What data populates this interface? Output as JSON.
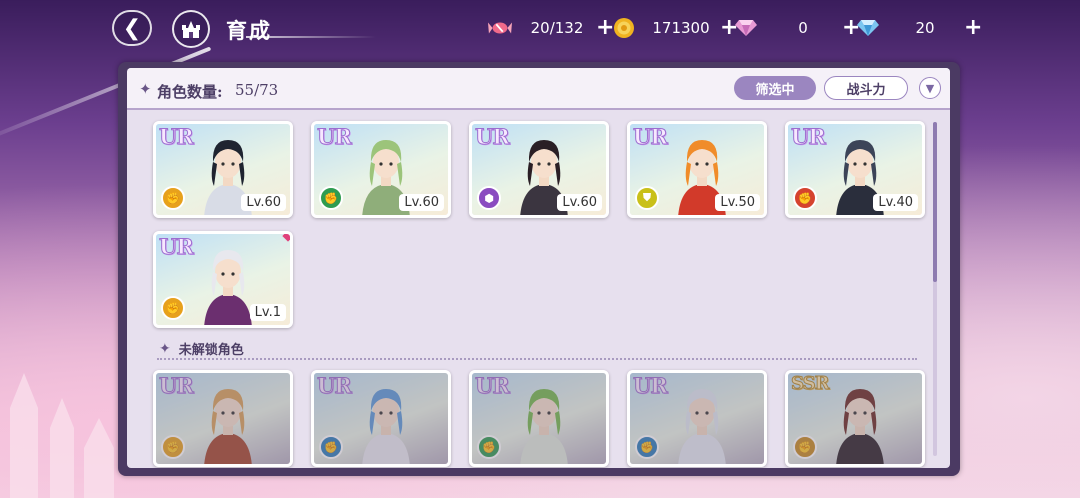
{
  "header": {
    "back_icon": "back-arrow-icon",
    "home_icon": "castle-icon",
    "title": "育成"
  },
  "resources": [
    {
      "icon": "candy-icon",
      "value": "20/132",
      "plus": "+"
    },
    {
      "icon": "gold-coin-icon",
      "value": "171300",
      "plus": "+"
    },
    {
      "icon": "pink-diamond-icon",
      "value": "0",
      "plus": "+"
    },
    {
      "icon": "blue-diamond-icon",
      "value": "20",
      "plus": "+"
    }
  ],
  "panel": {
    "count_label": "角色数量:",
    "count_value": "55/73",
    "filter_label": "筛选中",
    "sort_label": "战斗力",
    "order_icon": "chevron-down-icon"
  },
  "owned": [
    {
      "rarity": "UR",
      "level": "Lv.60",
      "role": "fist-icon",
      "role_color": "#e7a11c",
      "hair": "#1f2430",
      "outfit": "#d8dce6"
    },
    {
      "rarity": "UR",
      "level": "Lv.60",
      "role": "fist-icon",
      "role_color": "#2f9c50",
      "hair": "#9cc47a",
      "outfit": "#8fae7a"
    },
    {
      "rarity": "UR",
      "level": "Lv.60",
      "role": "boot-icon",
      "role_color": "#8a4bc0",
      "hair": "#2a1f25",
      "outfit": "#3b3540"
    },
    {
      "rarity": "UR",
      "level": "Lv.50",
      "role": "shield-icon",
      "role_color": "#c9c019",
      "hair": "#f08c2a",
      "outfit": "#d23a2a"
    },
    {
      "rarity": "UR",
      "level": "Lv.40",
      "role": "fist-icon",
      "role_color": "#d5432e",
      "hair": "#3c4458",
      "outfit": "#2a2e3c"
    },
    {
      "rarity": "UR",
      "level": "Lv.1",
      "role": "fist-icon",
      "role_color": "#e7a11c",
      "hair": "#e8e8ee",
      "outfit": "#6b2f6f",
      "new": true
    }
  ],
  "locked_title": "未解锁角色",
  "locked": [
    {
      "rarity": "UR",
      "role_color": "#e7a11c",
      "hair": "#d9a25a",
      "outfit": "#a5452c"
    },
    {
      "rarity": "UR",
      "role_color": "#2b7dbb",
      "hair": "#5b9ad9",
      "outfit": "#e8e8f0"
    },
    {
      "rarity": "UR",
      "role_color": "#2f9c50",
      "hair": "#74b84c",
      "outfit": "#dfe9dc"
    },
    {
      "rarity": "UR",
      "role_color": "#2b7dbb",
      "hair": "#dfe6f0",
      "outfit": "#e4e8f2"
    },
    {
      "rarity": "SSR",
      "role_color": "#c78a1f",
      "hair": "#6a2a22",
      "outfit": "#2a2026"
    }
  ]
}
